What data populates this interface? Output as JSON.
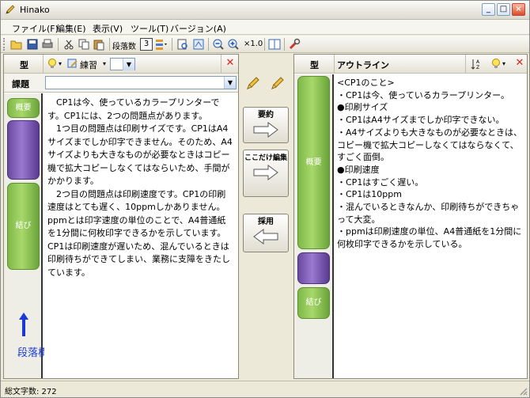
{
  "window": {
    "title": "Hinako"
  },
  "menu": [
    "ファイル(F)",
    "編集(E)",
    "表示(V)",
    "ツール(T)",
    "バージョン(A)"
  ],
  "toolbar": {
    "paragraph_label": "段落数",
    "paragraph_count": "3",
    "zoom_label": "×1.0"
  },
  "left_panel": {
    "type_label": "型",
    "style_select": "練習",
    "task_label": "課題",
    "task_value": "",
    "buttons": [
      "概要",
      "結び"
    ],
    "body": [
      "CP1は今、使っているカラープリンターです。CP1には、2つの問題点があります。",
      "1つ目の問題点は印刷サイズです。CP1はA4サイズまでしか印字できません。そのため、A4サイズよりも大きなものが必要なときはコピー機で拡大コピーしなくてはならいため、手間がかかります。",
      "2つ目の問題点は印刷速度です。CP1の印刷速度はとても遅く、10ppmしかありません。ppmとは印字速度の単位のことで、A4普通紙を1分間に何枚印字できるかを示しています。CP1は印刷速度が遅いため、混んでいるときは印刷待ちができてしまい、業務に支障をきたしています。"
    ],
    "caption": "段落構成ボタン"
  },
  "middle": {
    "summary_label": "要約",
    "only_here_label": "ここだけ編集",
    "adopt_label": "採用"
  },
  "right_panel": {
    "type_label": "型",
    "outline_label": "アウトライン",
    "buttons": [
      "概要",
      "結び"
    ],
    "lines": [
      "<CP1のこと>",
      "・CP1は今、使っているカラープリンター。",
      "●印刷サイズ",
      "・CP1はA4サイズまでしか印字できない。",
      "・A4サイズよりも大きなものが必要なときは、コピー機で拡大コピーしなくてはならなくて、すごく面倒。",
      "●印刷速度",
      "・CP1はすごく遅い。",
      "・CP1は10ppm",
      "・混んでいるときなんか、印刷待ちができちゃって大変。",
      "・ppmは印刷速度の単位、A4普通紙を1分間に何枚印字できるかを示している。"
    ]
  },
  "status": {
    "total_chars": "総文字数: 272"
  },
  "colors": {
    "accent_green": "#8cc653",
    "accent_purple": "#7a5ab8",
    "caption_blue": "#1a3ad8",
    "close_red": "#d22222"
  }
}
